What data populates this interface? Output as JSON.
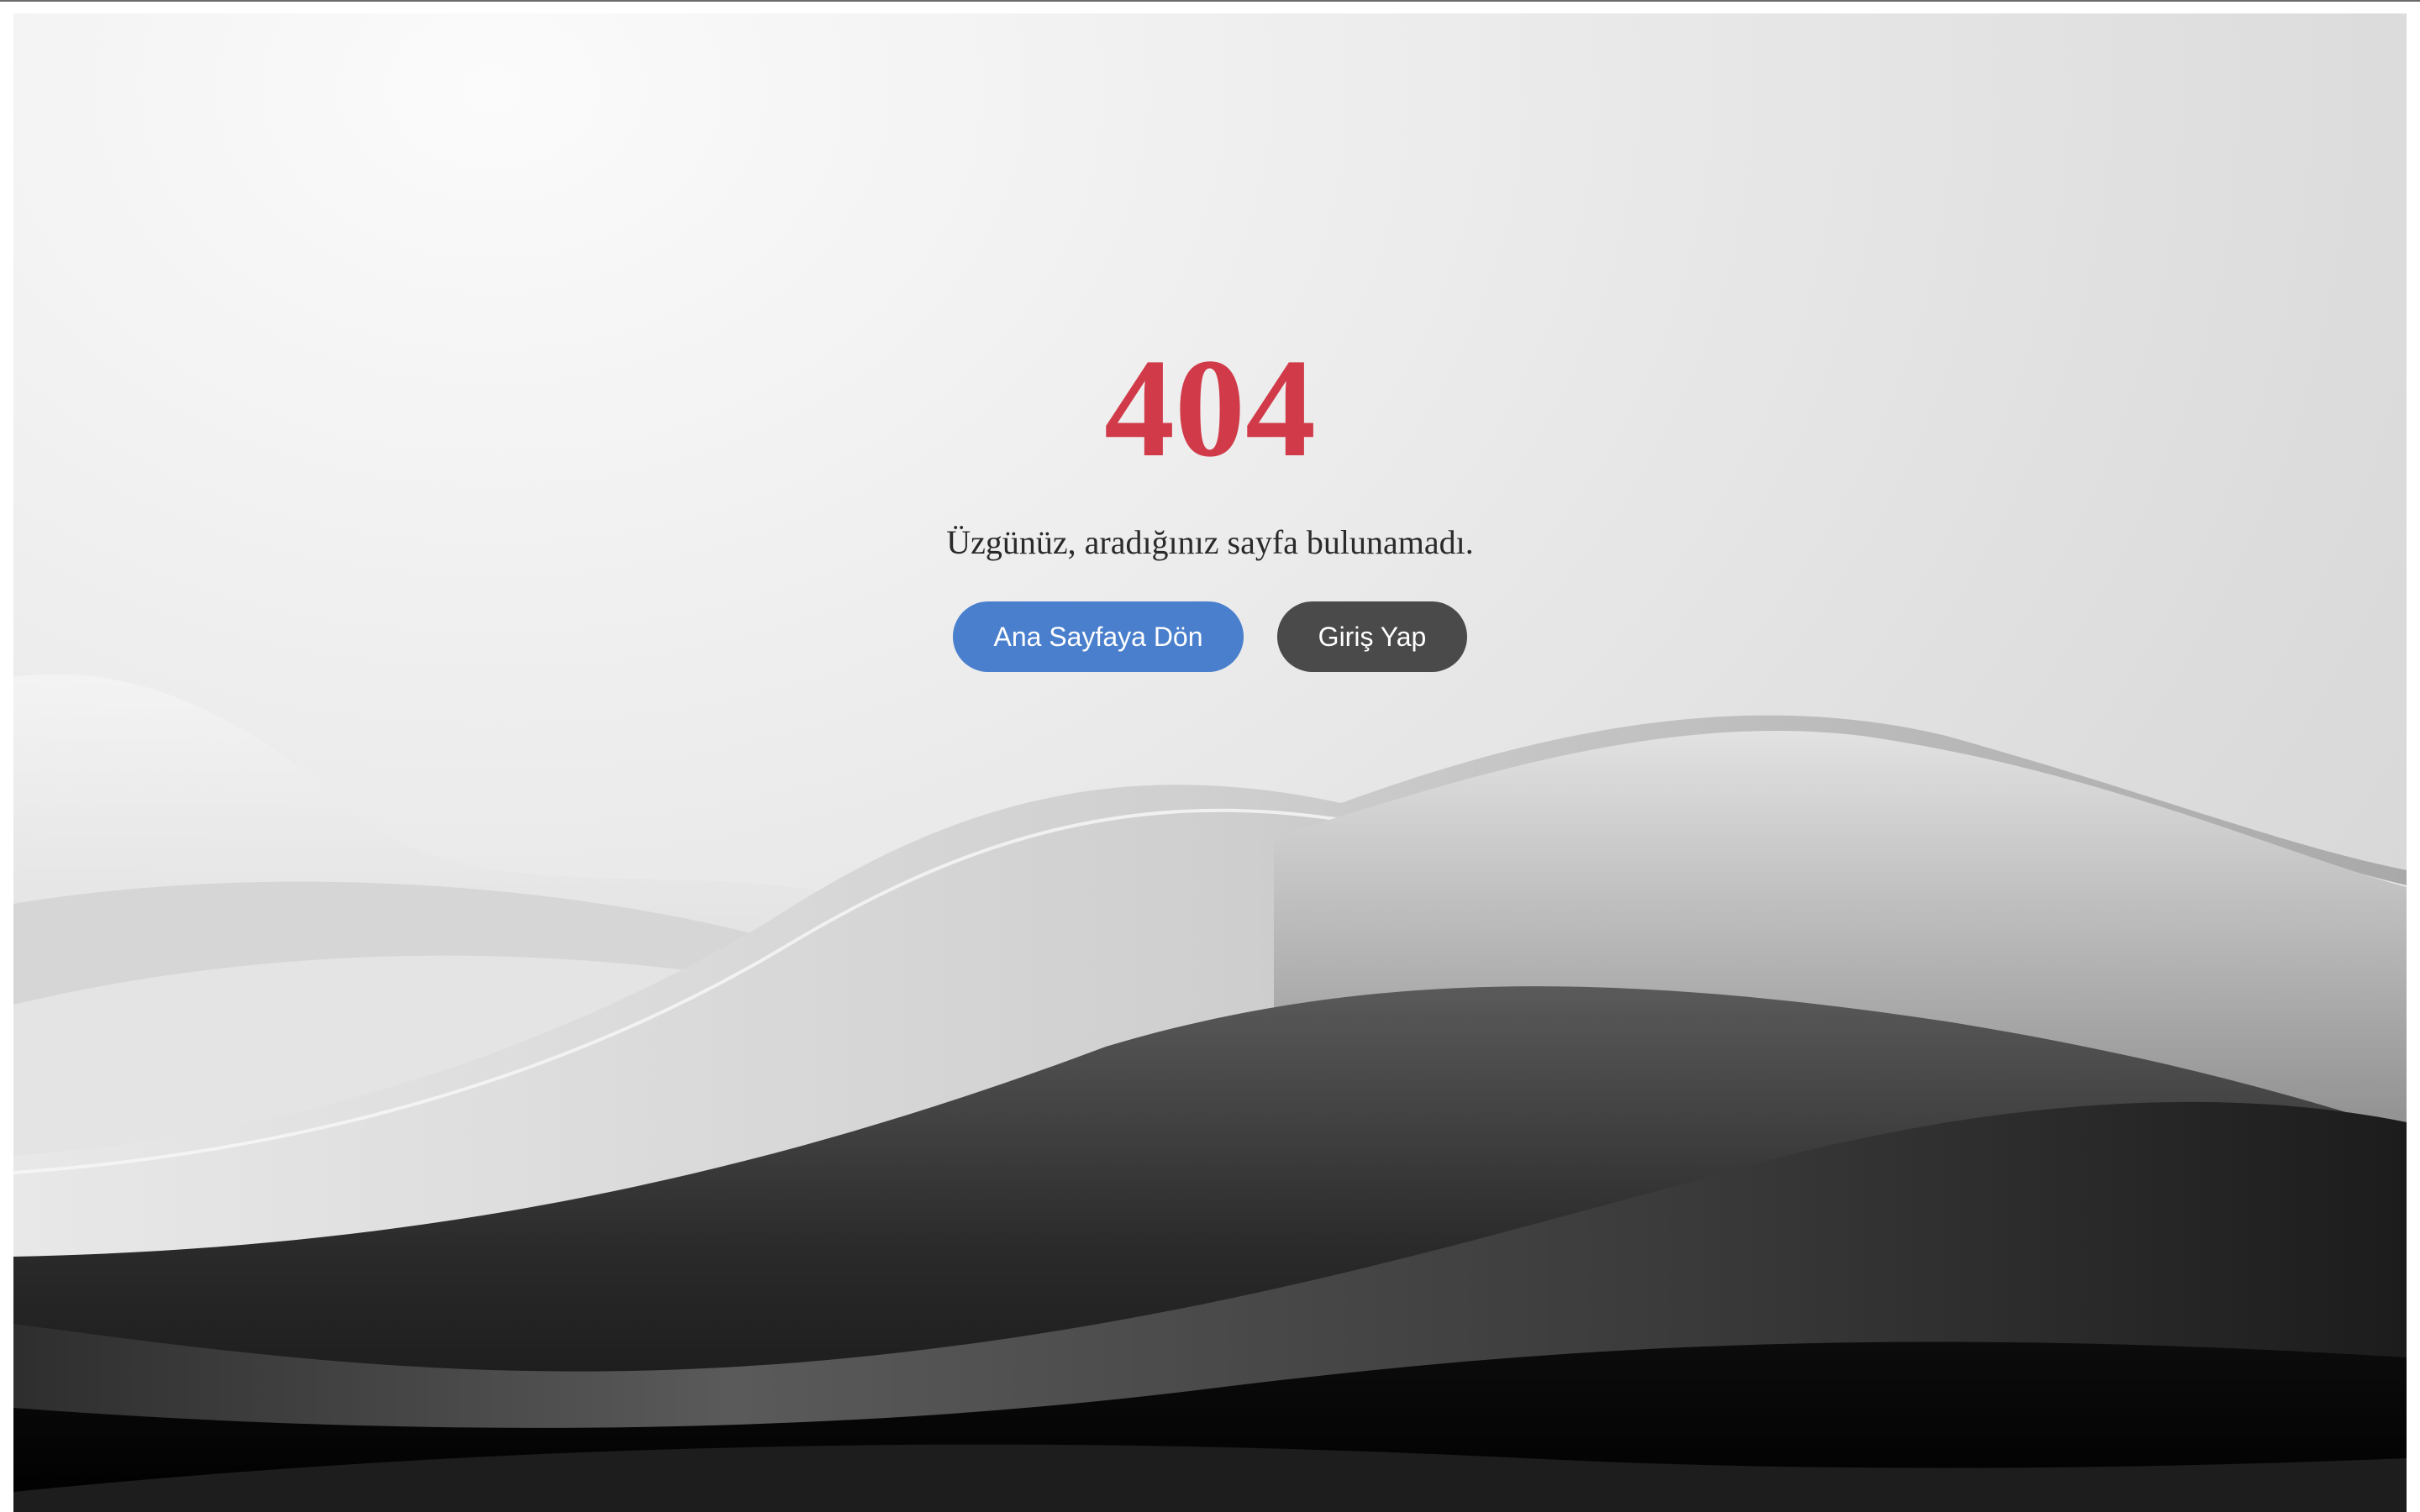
{
  "error": {
    "code": "404",
    "message": "Üzgünüz, aradığınız sayfa bulunamadı."
  },
  "actions": {
    "home_label": "Ana Sayfaya Dön",
    "login_label": "Giriş Yap"
  },
  "colors": {
    "error_code": "#d13a48",
    "home_button": "#4a7fcd",
    "login_button": "#4a4a4a"
  }
}
